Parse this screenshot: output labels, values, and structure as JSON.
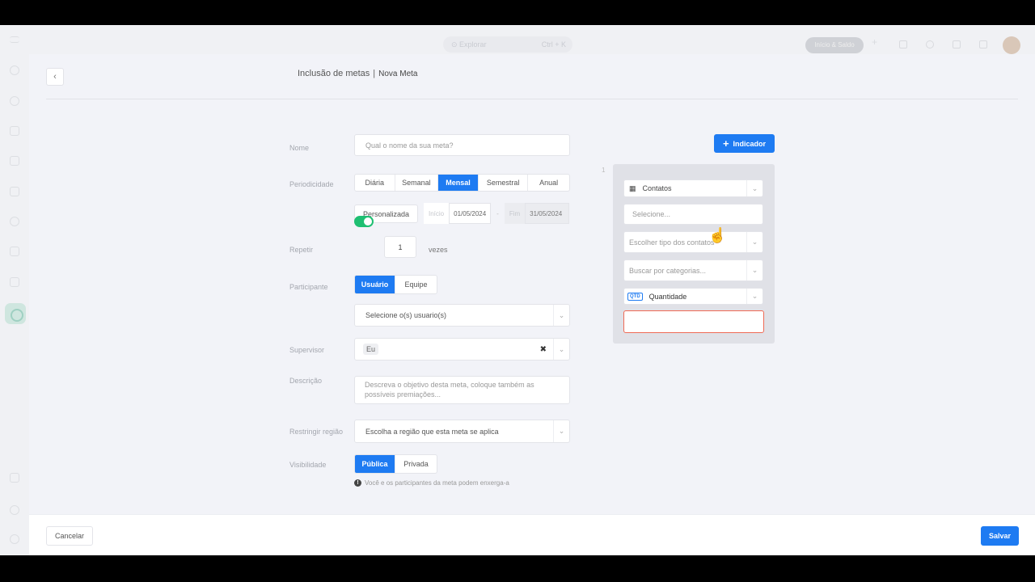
{
  "topbar": {
    "search_placeholder": "Explorar",
    "search_shortcut": "Ctrl + K",
    "pill_label": "Início & Saldo"
  },
  "modal": {
    "back_icon": "chevron-left-icon",
    "title": "Inclusão de metas",
    "separator": "|",
    "subtitle": "Nova Meta",
    "form": {
      "nome": {
        "label": "Nome",
        "placeholder": "Qual o nome da sua meta?"
      },
      "periodicidade": {
        "label": "Periodicidade",
        "options": [
          "Diária",
          "Semanal",
          "Mensal",
          "Semestral",
          "Anual"
        ],
        "selected": "Mensal"
      },
      "personalizada_label": "Personalizada",
      "inicio": {
        "label": "Início",
        "value": "01/05/2024"
      },
      "date_separator": "-",
      "fim": {
        "label": "Fim",
        "value": "31/05/2024"
      },
      "repetir": {
        "label": "Repetir",
        "enabled": true,
        "count": "1",
        "suffix": "vezes"
      },
      "participante": {
        "label": "Participante",
        "options": [
          "Usuário",
          "Equipe"
        ],
        "selected": "Usuário",
        "user_select_placeholder": "Selecione o(s) usuario(s)"
      },
      "supervisor": {
        "label": "Supervisor",
        "value": "Eu",
        "clear_icon": "close-icon"
      },
      "descricao": {
        "label": "Descrição",
        "placeholder": "Descreva o objetivo desta meta, coloque também as possíveis premiações..."
      },
      "regiao": {
        "label": "Restringir região",
        "placeholder": "Escolha a região que esta meta se aplica"
      },
      "visibilidade": {
        "label": "Visibilidade",
        "options": [
          "Pública",
          "Privada"
        ],
        "selected": "Pública",
        "hint": "Você e os participantes da meta podem enxerga-a"
      }
    },
    "indicador": {
      "button_label": "Indicador",
      "button_icon": "plus-icon",
      "index": "1",
      "tipo": {
        "icon": "building-icon",
        "value": "Contatos"
      },
      "selecione_placeholder": "Selecione...",
      "tipo_contatos_placeholder": "Escolher tipo dos contatos",
      "categorias_placeholder": "Buscar por categorias...",
      "metrica": {
        "badge": "QTD",
        "value": "Quantidade"
      },
      "valor_value": ""
    },
    "footer": {
      "cancel_label": "Cancelar",
      "save_label": "Salvar"
    }
  },
  "colors": {
    "primary": "#1e7bf2",
    "toggle_on": "#1fbf72",
    "error_border": "#ef6a55"
  }
}
